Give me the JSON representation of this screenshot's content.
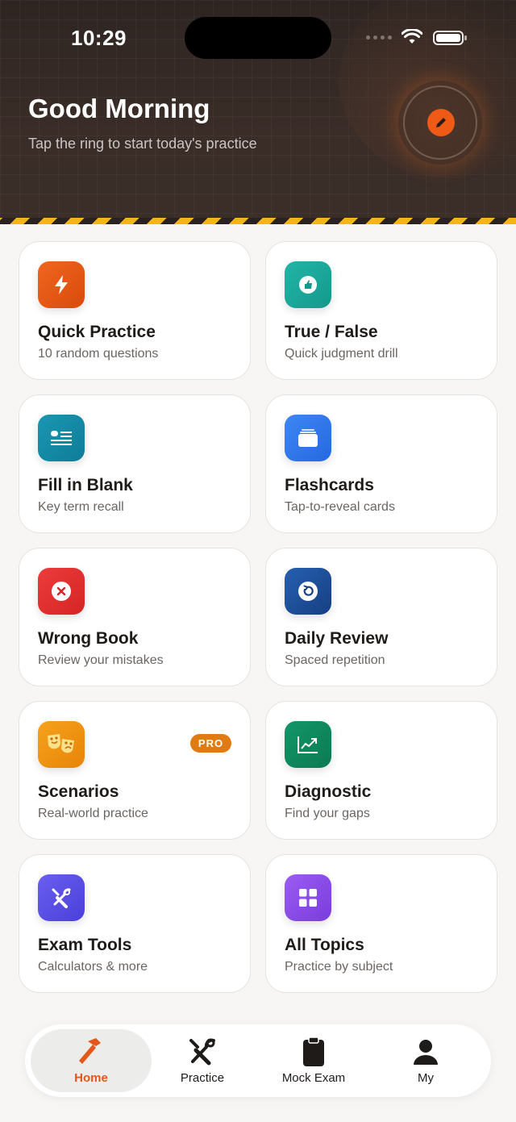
{
  "status_bar": {
    "time": "10:29"
  },
  "header": {
    "greeting": "Good Morning",
    "subtitle": "Tap the ring to start today's practice",
    "ring_icon": "pencil-icon"
  },
  "cards": [
    {
      "title": "Quick Practice",
      "desc": "10 random questions",
      "icon": "lightning-icon",
      "color": "#e8540f"
    },
    {
      "title": "True / False",
      "desc": "Quick judgment drill",
      "icon": "thumbs-up-icon",
      "color": "#1aa79a"
    },
    {
      "title": "Fill in Blank",
      "desc": "Key term recall",
      "icon": "text-lines-icon",
      "color": "#118aa6"
    },
    {
      "title": "Flashcards",
      "desc": "Tap-to-reveal cards",
      "icon": "cards-stack-icon",
      "color": "#2f78ef"
    },
    {
      "title": "Wrong Book",
      "desc": "Review your mistakes",
      "icon": "x-circle-icon",
      "color": "#e02f2f"
    },
    {
      "title": "Daily Review",
      "desc": "Spaced repetition",
      "icon": "refresh-icon",
      "color": "#1b4f9c"
    },
    {
      "title": "Scenarios",
      "desc": "Real-world practice",
      "icon": "theater-masks-icon",
      "color": "#f0920c",
      "badge": "PRO"
    },
    {
      "title": "Diagnostic",
      "desc": "Find your gaps",
      "icon": "trend-chart-icon",
      "color": "#0f8a59"
    },
    {
      "title": "Exam Tools",
      "desc": "Calculators & more",
      "icon": "tools-icon",
      "color": "#5a4fe8"
    },
    {
      "title": "All Topics",
      "desc": "Practice by subject",
      "icon": "grid-icon",
      "color": "#8a4ce6"
    }
  ],
  "tabbar": {
    "items": [
      {
        "label": "Home",
        "icon": "hammer-icon",
        "active": true
      },
      {
        "label": "Practice",
        "icon": "tools-icon"
      },
      {
        "label": "Mock Exam",
        "icon": "clipboard-icon"
      },
      {
        "label": "My",
        "icon": "person-icon"
      }
    ],
    "active_color": "#e4571a"
  }
}
